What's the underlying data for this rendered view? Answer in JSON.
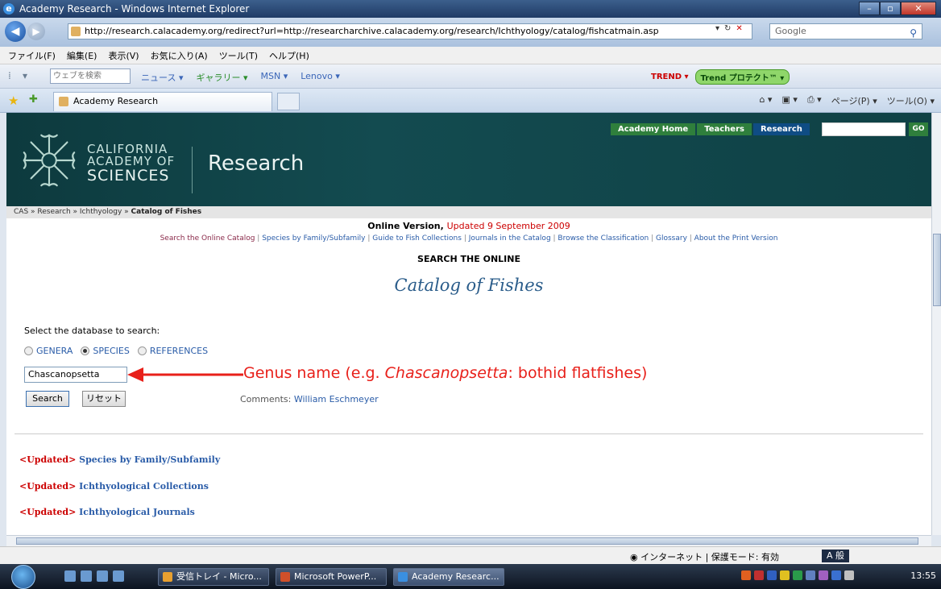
{
  "window": {
    "title": "Academy Research - Windows Internet Explorer"
  },
  "address": {
    "url": "http://research.calacademy.org/redirect?url=http://researcharchive.calacademy.org/research/Ichthyology/catalog/fishcatmain.asp",
    "search_placeholder": "Google"
  },
  "menu": [
    "ファイル(F)",
    "編集(E)",
    "表示(V)",
    "お気に入り(A)",
    "ツール(T)",
    "ヘルプ(H)"
  ],
  "toolbar": {
    "web_search_placeholder": "ウェブを検索",
    "links": [
      "ニュース ▾",
      "ギャラリー ▾",
      "MSN ▾",
      "Lenovo ▾"
    ],
    "trend": "TREND ▾",
    "trend_protect": "Trend プロテクト™ ▾"
  },
  "tab": {
    "label": "Academy Research"
  },
  "commandbar": {
    "page": "ページ(P) ▾",
    "tools": "ツール(O) ▾"
  },
  "site": {
    "org_line1": "CALIFORNIA",
    "org_line2": "ACADEMY OF",
    "org_line3": "SCIENCES",
    "section": "Research",
    "nav": [
      "Academy Home",
      "Teachers",
      "Research"
    ],
    "go": "GO"
  },
  "breadcrumb": {
    "path": "CAS » Research » Ichthyology » ",
    "current": "Catalog of Fishes"
  },
  "page": {
    "online_version": "Online Version, ",
    "updated": "Updated 9 September 2009",
    "sublinks": [
      "Search the Online Catalog",
      "Species by Family/Subfamily",
      "Guide to Fish Collections",
      "Journals in the Catalog",
      "Browse the Classification",
      "Glossary",
      "About the Print Version"
    ],
    "search_the_online": "SEARCH THE ONLINE",
    "catalog_title": "Catalog of Fishes",
    "select_db": "Select the database to search:",
    "radios": [
      "GENERA",
      "SPECIES",
      "REFERENCES"
    ],
    "selected_radio": "SPECIES",
    "search_term": "Chascanopsetta",
    "annotation_prefix": "Genus name (e.g. ",
    "annotation_italic": "Chascanopsetta",
    "annotation_suffix": ": bothid flatfishes)",
    "search_button": "Search",
    "reset_button": "リセット",
    "comments_label": "Comments: ",
    "comments_name": "William Eschmeyer",
    "updated_tag": "<Updated>",
    "updated_links": [
      "Species by Family/Subfamily",
      "Ichthyological Collections",
      "Ichthyological Journals"
    ]
  },
  "statusbar": {
    "zone": "インターネット | 保護モード: 有効"
  },
  "taskbar": {
    "items": [
      "受信トレイ - Micro...",
      "Microsoft PowerP...",
      "Academy Researc..."
    ],
    "lang": "A 般",
    "clock": "13:55"
  },
  "colors": {
    "header_bg": "#134b50",
    "nav_green": "#2f7f3c",
    "nav_active": "#0f4c84",
    "link_blue": "#2a5ca8",
    "updated_red": "#cc0000",
    "annotation_red": "#e8201a"
  }
}
